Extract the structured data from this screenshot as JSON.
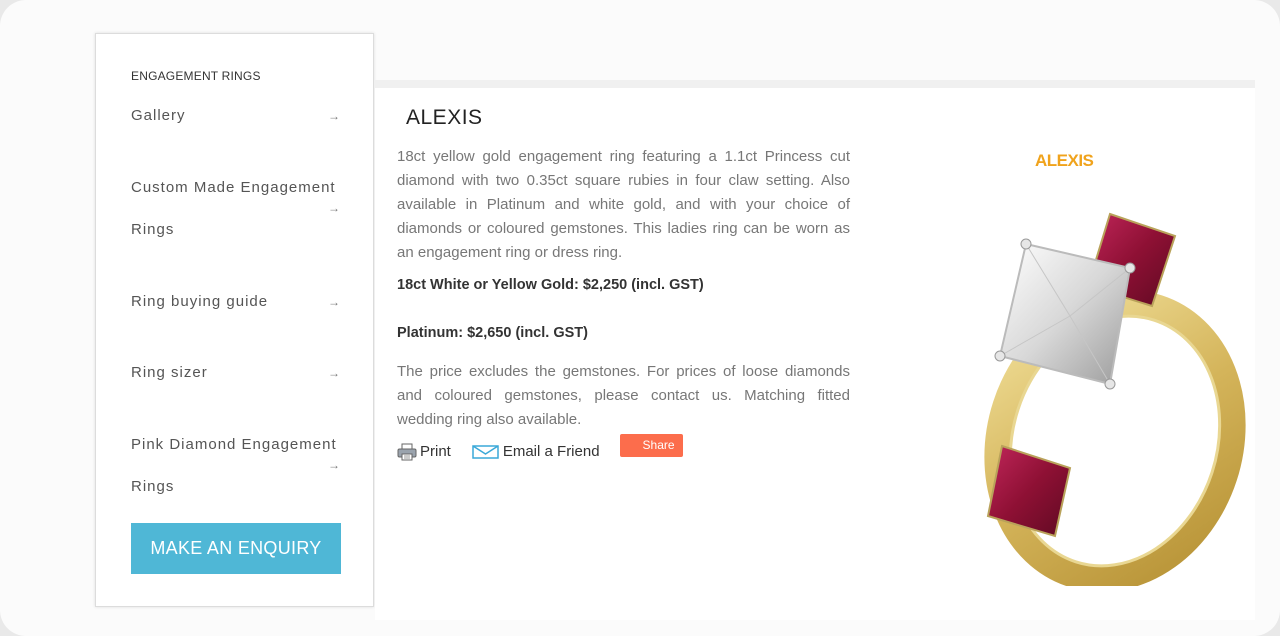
{
  "sidebar": {
    "heading": "ENGAGEMENT RINGS",
    "items": [
      {
        "label": "Gallery",
        "arrow": "→"
      },
      {
        "label": "Custom Made Engagement Rings",
        "arrow": "→"
      },
      {
        "label": "Ring buying guide",
        "arrow": "→"
      },
      {
        "label": "Ring sizer",
        "arrow": "→"
      },
      {
        "label": "Pink Diamond Engagement Rings",
        "arrow": "→"
      }
    ],
    "enquiry_label": "MAKE AN ENQUIRY"
  },
  "product": {
    "title": "ALEXIS",
    "description": "18ct yellow gold engagement ring featuring a 1.1ct Princess cut diamond with two 0.35ct square rubies in four claw setting. Also available in Platinum and white gold, and with your choice of diamonds or coloured gemstones. This ladies ring can be worn as an engagement ring or dress ring.",
    "price_gold": "18ct White or Yellow Gold: $2,250 (incl. GST)",
    "price_platinum": "Platinum: $2,650 (incl. GST)",
    "note": "The price excludes the gemstones. For prices of loose diamonds and coloured gemstones, please contact us. Matching fitted wedding ring also available.",
    "image_title": "ALEXIS"
  },
  "actions": {
    "print": "Print",
    "email": "Email a Friend",
    "share": "Share"
  },
  "colors": {
    "enquiry": "#4fb7d6",
    "share": "#fc6d4c",
    "image_title": "#f0a31c"
  }
}
